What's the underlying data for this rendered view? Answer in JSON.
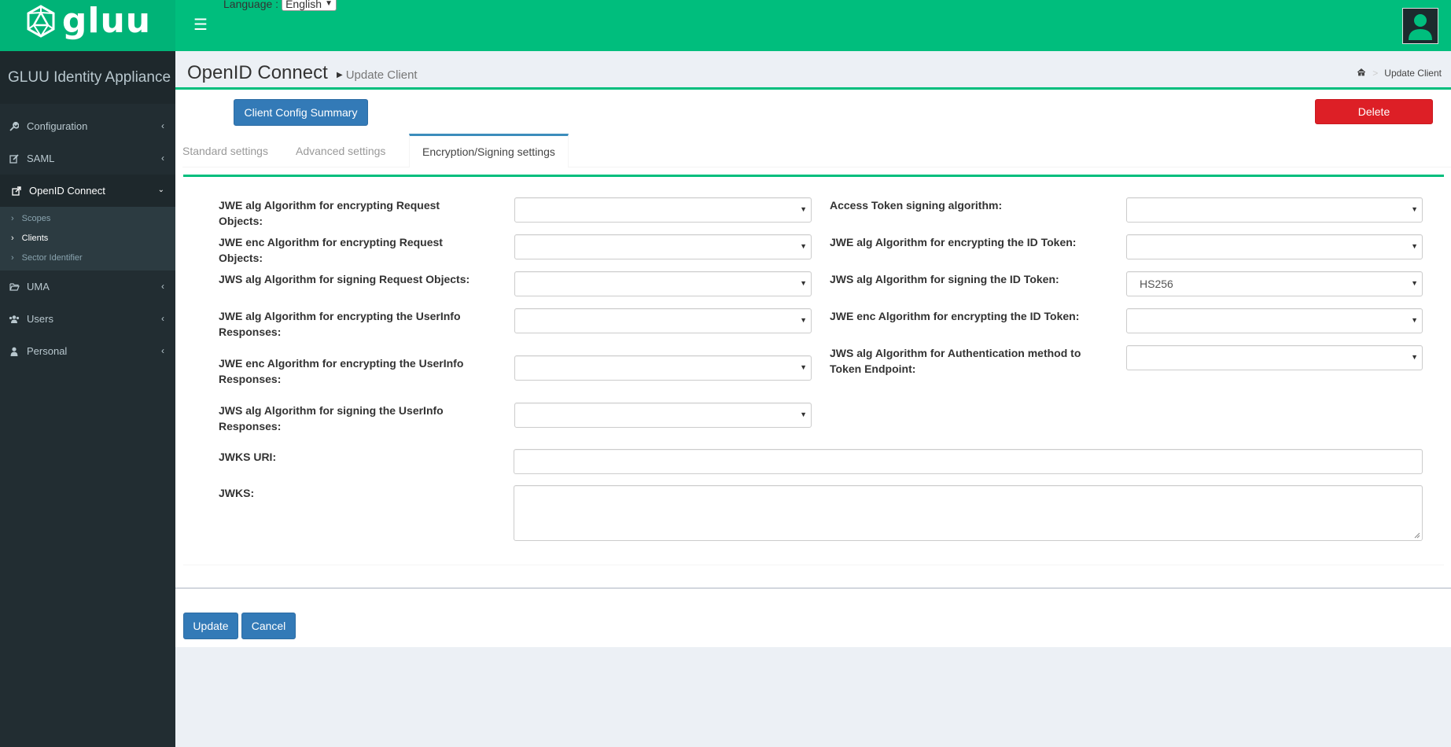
{
  "header": {
    "logo_text": "gluu",
    "language_label": "Language :",
    "language_value": "English"
  },
  "sidebar": {
    "brand": "GLUU Identity Appliance",
    "items": [
      {
        "label": "Configuration",
        "icon": "wrench-icon"
      },
      {
        "label": "SAML",
        "icon": "edit-icon"
      },
      {
        "label": "OpenID Connect",
        "icon": "external-link-icon"
      },
      {
        "label": "UMA",
        "icon": "folder-open-icon"
      },
      {
        "label": "Users",
        "icon": "users-icon"
      },
      {
        "label": "Personal",
        "icon": "user-icon"
      }
    ],
    "openid_sub": [
      "Scopes",
      "Clients",
      "Sector Identifier"
    ]
  },
  "content_header": {
    "title": "OpenID Connect",
    "subtitle": "Update Client",
    "breadcrumb_current": "Update Client"
  },
  "actions": {
    "summary_label": "Client Config Summary",
    "delete_label": "Delete",
    "update_label": "Update",
    "cancel_label": "Cancel"
  },
  "tabs": [
    "Standard settings",
    "Advanced settings",
    "Encryption/Signing settings"
  ],
  "form": {
    "left_labels": [
      "JWE alg Algorithm for encrypting Request Objects:",
      "JWE enc Algorithm for encrypting Request Objects:",
      "JWS alg Algorithm for signing Request Objects:",
      "JWE alg Algorithm for encrypting the UserInfo Responses:",
      "JWE enc Algorithm for encrypting the UserInfo Responses:",
      "JWS alg Algorithm for signing the UserInfo Responses:"
    ],
    "right_labels": [
      "Access Token signing algorithm:",
      "JWE alg Algorithm for encrypting the ID Token:",
      "JWS alg Algorithm for signing the ID Token:",
      "JWE enc Algorithm for encrypting the ID Token:",
      "JWS alg Algorithm for Authentication method to Token Endpoint:"
    ],
    "right_values": [
      "",
      "",
      "HS256",
      "",
      ""
    ],
    "jwks_uri_label": "JWKS URI:",
    "jwks_label": "JWKS:",
    "jwks_uri_value": "",
    "jwks_value": ""
  },
  "colors": {
    "brand_green": "#00be7d",
    "sidebar_bg": "#222d32",
    "primary": "#337ab7",
    "danger": "#dd1f26"
  }
}
